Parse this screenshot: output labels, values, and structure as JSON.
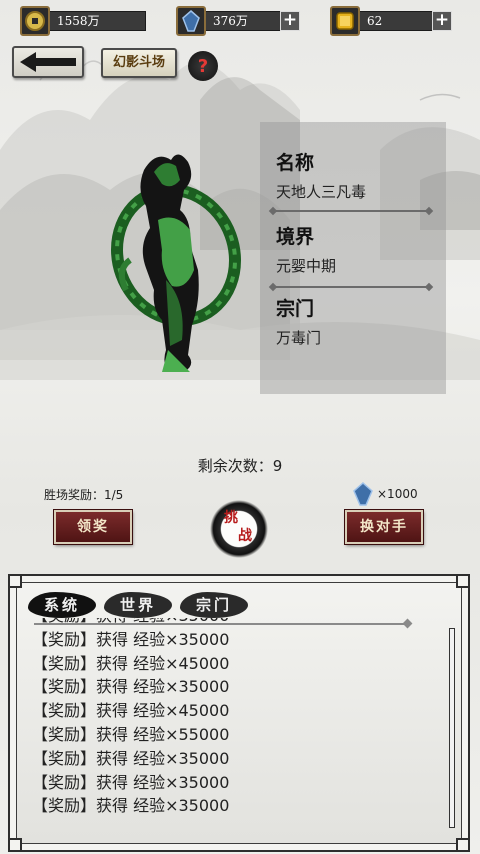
{
  "resources": [
    {
      "icon": "spirit-stone-coin-icon",
      "value": "1558万",
      "has_plus": false
    },
    {
      "icon": "blue-crystal-icon",
      "value": "376万",
      "has_plus": true
    },
    {
      "icon": "gold-ingot-icon",
      "value": "62",
      "has_plus": true
    }
  ],
  "nav": {
    "back_icon": "left-arrow-icon",
    "arena_label": "幻影斗场",
    "help_label": "?"
  },
  "opponent": {
    "name_label": "名称",
    "name_value": "天地人三凡毒",
    "realm_label": "境界",
    "realm_value": "元婴中期",
    "sect_label": "宗门",
    "sect_value": "万毒门"
  },
  "arena": {
    "remaining_text": "剩余次数：9",
    "win_reward_text": "胜场奖励：1/5",
    "prize_icon": "blue-crystal-icon",
    "prize_amount": "×1000",
    "claim_label": "领奖",
    "challenge_label_top": "挑",
    "challenge_label_bottom": "战",
    "swap_label": "换对手"
  },
  "chat": {
    "tabs": [
      {
        "label": "系统",
        "active": true
      },
      {
        "label": "世界",
        "active": false
      },
      {
        "label": "宗门",
        "active": false
      }
    ],
    "messages": [
      "【奖励】获得 经验×35000",
      "【奖励】获得 经验×35000",
      "【奖励】获得 经验×45000",
      "【奖励】获得 经验×35000",
      "【奖励】获得 经验×45000",
      "【奖励】获得 经验×55000",
      "【奖励】获得 经验×35000",
      "【奖励】获得 经验×35000",
      "【奖励】获得 经验×35000"
    ]
  },
  "colors": {
    "opponent_silhouette": "#2e7d32",
    "button_red": "#6a2020",
    "accent_gold": "#8a6d3b"
  }
}
